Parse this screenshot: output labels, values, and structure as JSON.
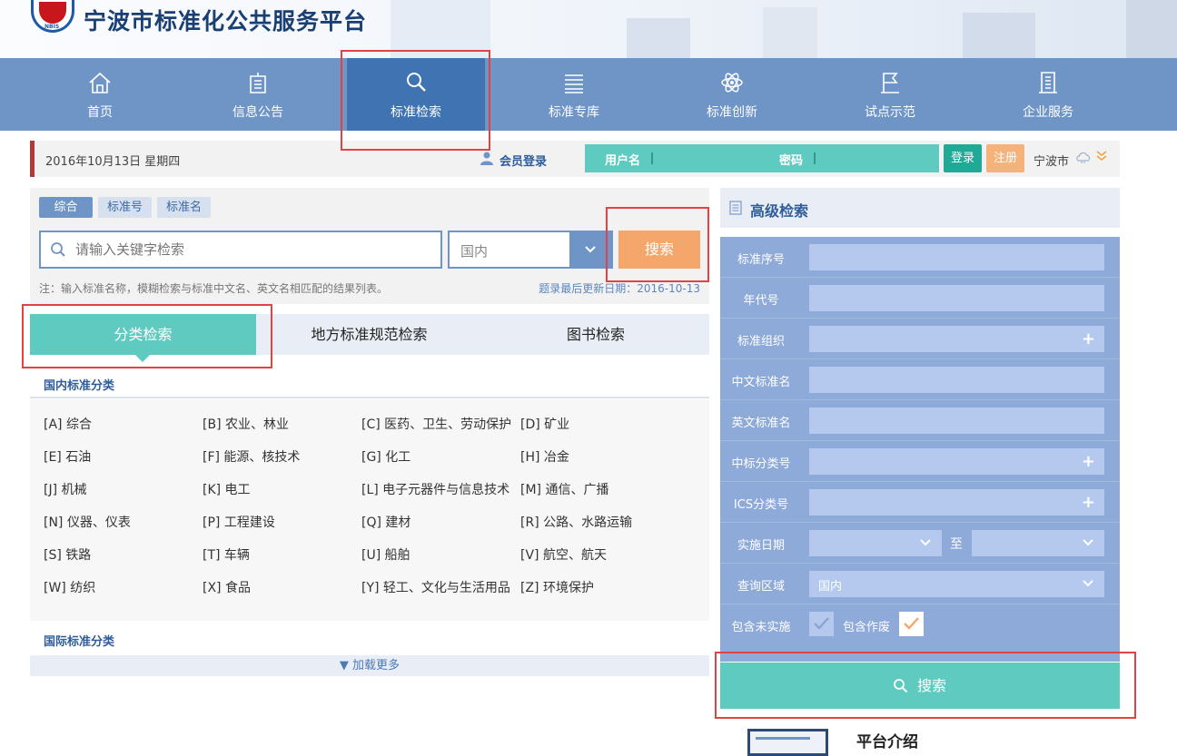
{
  "header": {
    "site_title": "宁波市标准化公共服务平台",
    "logo_text": "NBIS"
  },
  "nav": {
    "items": [
      {
        "label": "首页",
        "icon": "home-icon"
      },
      {
        "label": "信息公告",
        "icon": "notice-icon"
      },
      {
        "label": "标准检索",
        "icon": "search-icon",
        "active": true
      },
      {
        "label": "标准专库",
        "icon": "database-icon"
      },
      {
        "label": "标准创新",
        "icon": "atom-icon"
      },
      {
        "label": "试点示范",
        "icon": "flag-icon"
      },
      {
        "label": "企业服务",
        "icon": "building-icon"
      }
    ]
  },
  "infobar": {
    "date": "2016年10月13日 星期四",
    "member_login": "会员登录",
    "username_label": "用户名",
    "password_label": "密码",
    "login_button": "登录",
    "register_button": "注册",
    "city": "宁波市"
  },
  "search": {
    "tabs": [
      "综合",
      "标准号",
      "标准名"
    ],
    "keyword_placeholder": "请输入关键字检索",
    "region_value": "国内",
    "button": "搜索",
    "note": "注：输入标准名称，模糊检索与标准中文名、英文名相匹配的结果列表。",
    "update": "题录最后更新日期：2016-10-13"
  },
  "category_tabs": [
    "分类检索",
    "地方标准规范检索",
    "图书检索"
  ],
  "domestic": {
    "title": "国内标准分类",
    "items": [
      "[A] 综合",
      "[B] 农业、林业",
      "[C] 医药、卫生、劳动保护",
      "[D] 矿业",
      "[E] 石油",
      "[F] 能源、核技术",
      "[G] 化工",
      "[H] 冶金",
      "[J] 机械",
      "[K] 电工",
      "[L] 电子元器件与信息技术",
      "[M] 通信、广播",
      "[N] 仪器、仪表",
      "[P] 工程建设",
      "[Q] 建材",
      "[R] 公路、水路运输",
      "[S] 铁路",
      "[T] 车辆",
      "[U] 船舶",
      "[V] 航空、航天",
      "[W] 纺织",
      "[X] 食品",
      "[Y] 轻工、文化与生活用品",
      "[Z] 环境保护"
    ]
  },
  "international": {
    "title": "国际标准分类"
  },
  "load_more": "▼ 加载更多",
  "advanced": {
    "title": "高级检索",
    "fields": {
      "std_no": "标准序号",
      "year": "年代号",
      "org": "标准组织",
      "cn_name": "中文标准名",
      "en_name": "英文标准名",
      "ccs": "中标分类号",
      "ics": "ICS分类号",
      "impl_date": "实施日期",
      "to": "至",
      "area": "查询区域",
      "area_value": "国内",
      "include_unimpl": "包含未实施",
      "include_void": "包含作废"
    },
    "button": "搜索"
  },
  "intro": {
    "title": "平台介绍"
  },
  "colors": {
    "nav_bg": "#6f95c6",
    "nav_active": "#3f73b2",
    "teal": "#5fcbc0",
    "orange": "#f5a66b",
    "annotation_red": "#e04343"
  }
}
